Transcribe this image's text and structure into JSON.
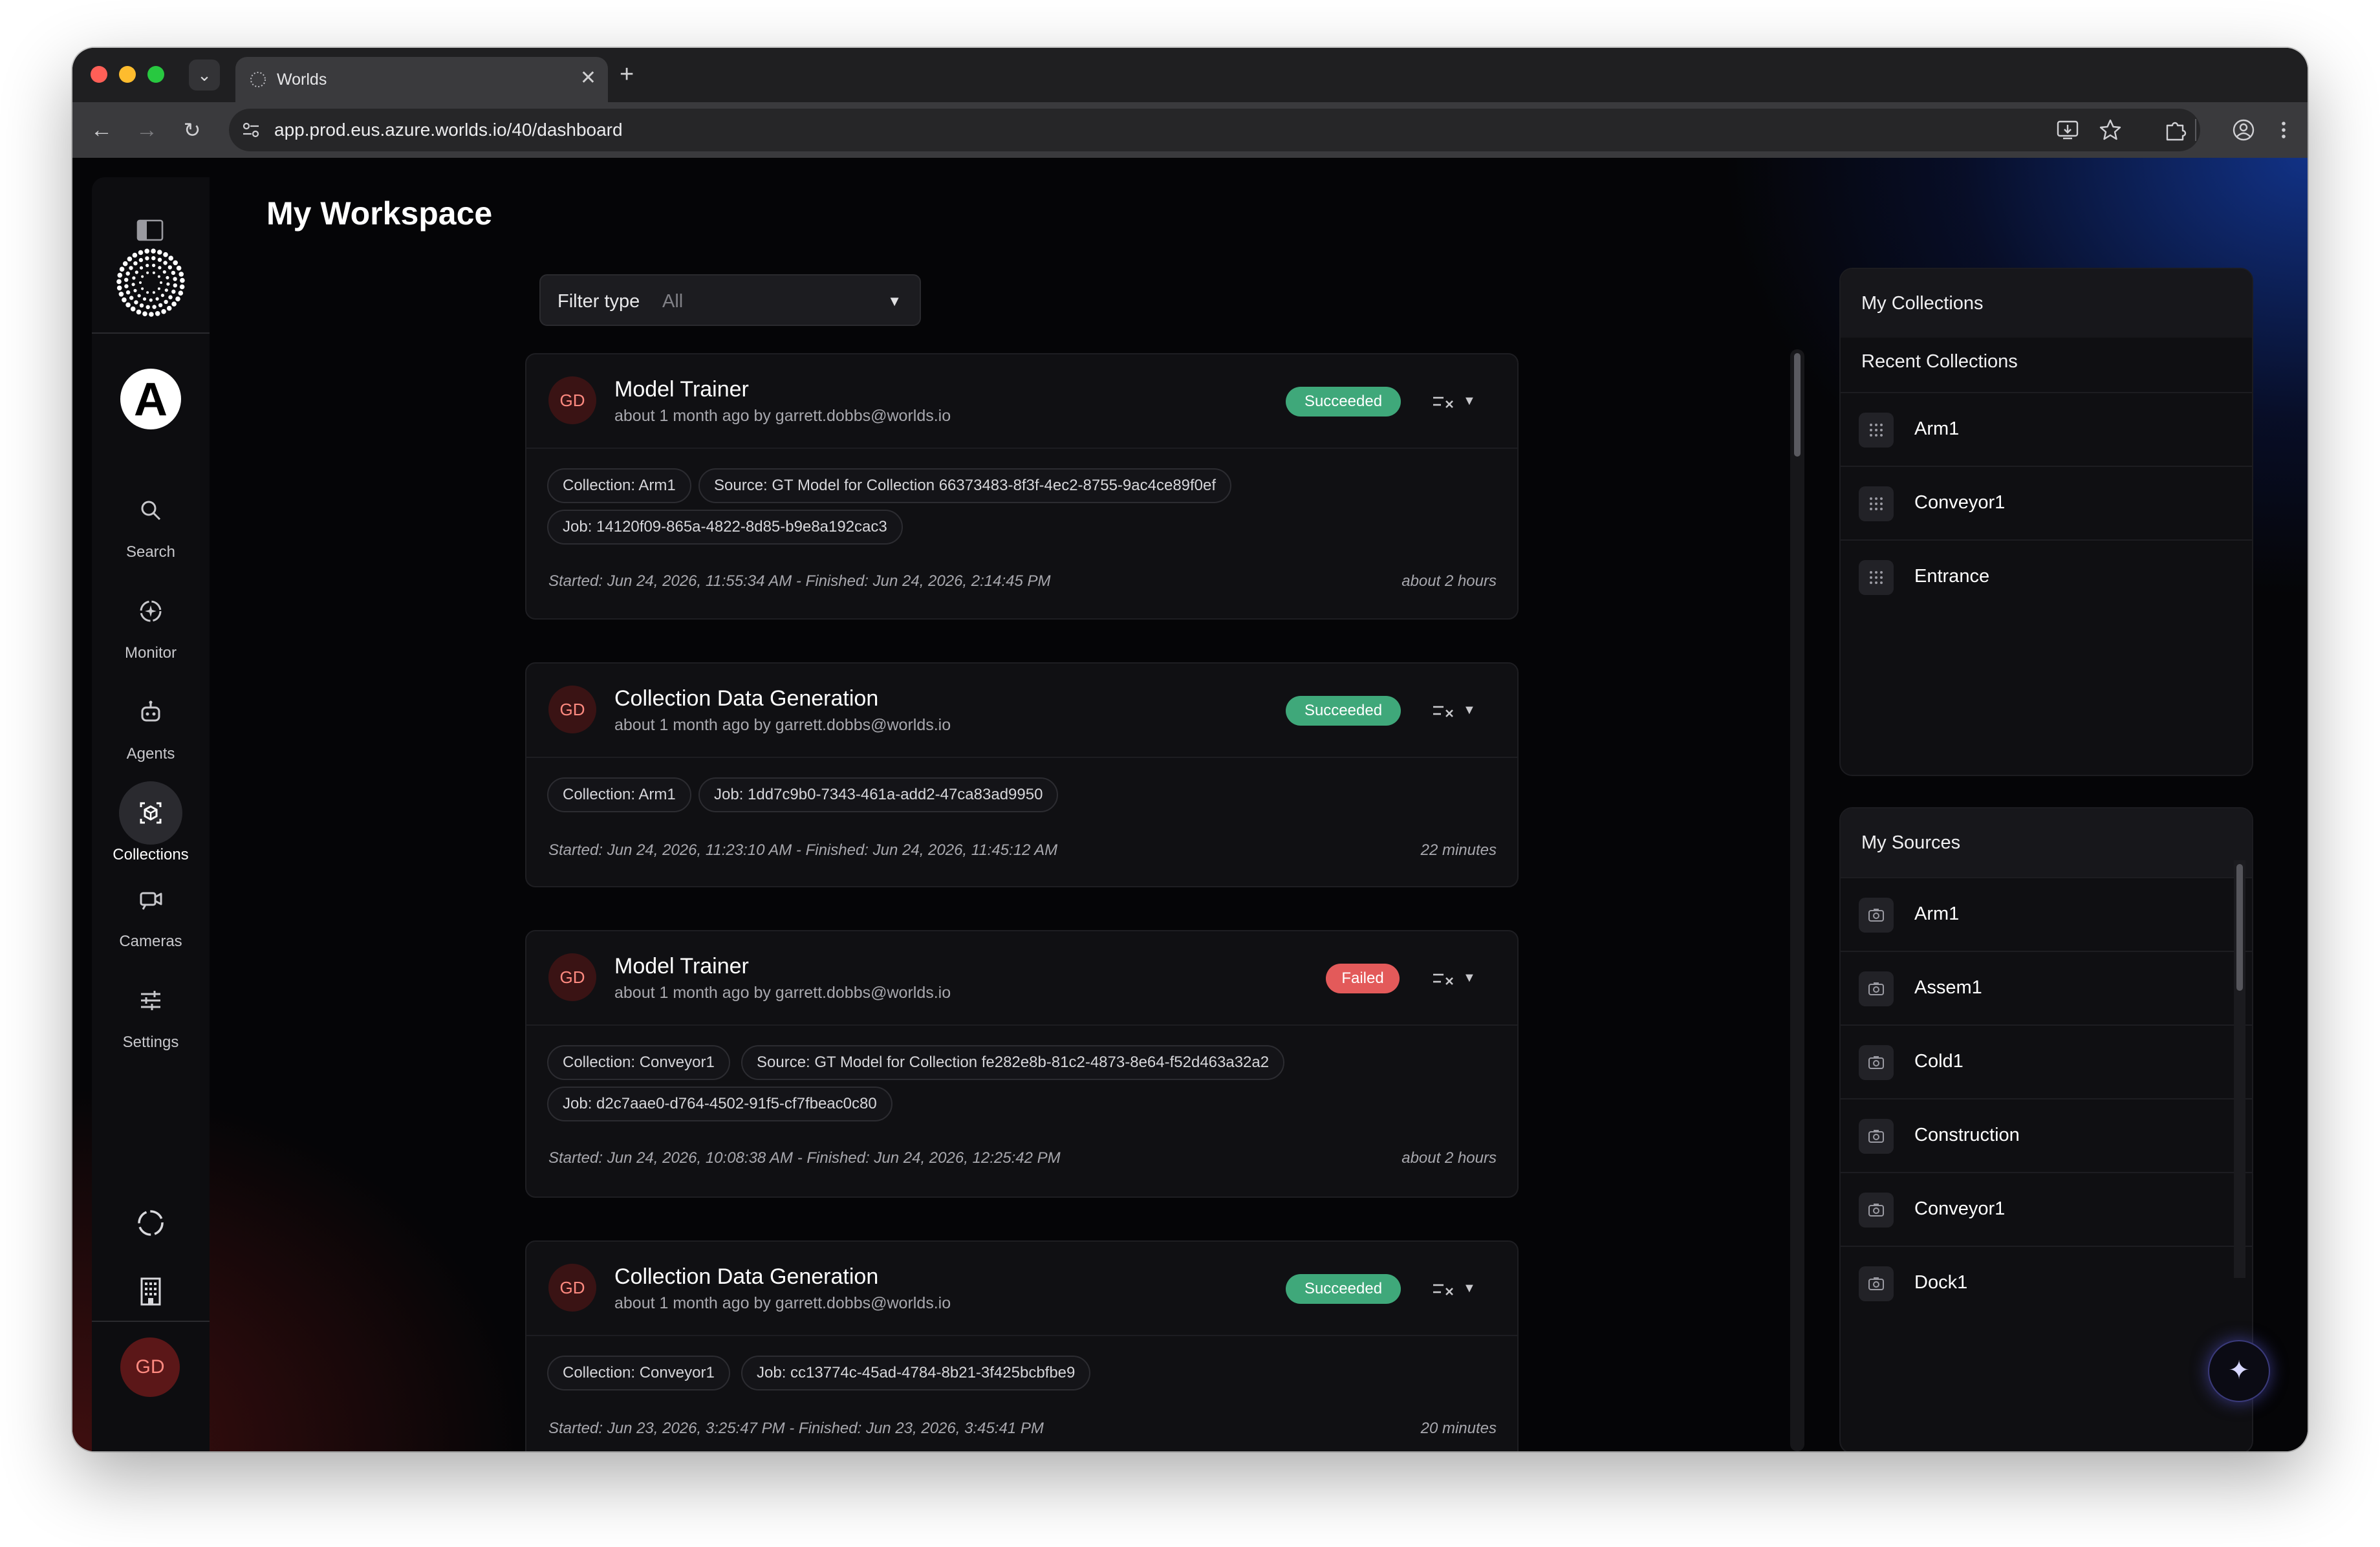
{
  "browser": {
    "tab_title": "Worlds",
    "tab_close": "✕",
    "new_tab": "+",
    "url": "app.prod.eus.azure.worlds.io/40/dashboard"
  },
  "sidebar": {
    "brand_letter": "A",
    "items": [
      {
        "label": "Search",
        "icon": "search-icon"
      },
      {
        "label": "Monitor",
        "icon": "monitor-icon"
      },
      {
        "label": "Agents",
        "icon": "robot-icon"
      },
      {
        "label": "Collections",
        "icon": "collections-icon",
        "active": true
      },
      {
        "label": "Cameras",
        "icon": "camera-icon"
      },
      {
        "label": "Settings",
        "icon": "sliders-icon"
      }
    ],
    "user_initials": "GD"
  },
  "page": {
    "title": "My Workspace"
  },
  "filter": {
    "label": "Filter type",
    "value": "All"
  },
  "jobs": [
    {
      "initials": "GD",
      "title": "Model Trainer",
      "subtitle": "about 1 month ago by garrett.dobbs@worlds.io",
      "status": "Succeeded",
      "chips": [
        "Collection: Arm1",
        "Source: GT Model for Collection 66373483-8f3f-4ec2-8755-9ac4ce89f0ef",
        "Job: 14120f09-865a-4822-8d85-b9e8a192cac3"
      ],
      "times": "Started: Jun 24, 2026, 11:55:34 AM - Finished: Jun 24, 2026, 2:14:45 PM",
      "duration": "about 2 hours"
    },
    {
      "initials": "GD",
      "title": "Collection Data Generation",
      "subtitle": "about 1 month ago by garrett.dobbs@worlds.io",
      "status": "Succeeded",
      "chips": [
        "Collection: Arm1",
        "Job: 1dd7c9b0-7343-461a-add2-47ca83ad9950"
      ],
      "times": "Started: Jun 24, 2026, 11:23:10 AM - Finished: Jun 24, 2026, 11:45:12 AM",
      "duration": "22 minutes"
    },
    {
      "initials": "GD",
      "title": "Model Trainer",
      "subtitle": "about 1 month ago by garrett.dobbs@worlds.io",
      "status": "Failed",
      "chips": [
        "Collection: Conveyor1",
        "Source: GT Model for Collection fe282e8b-81c2-4873-8e64-f52d463a32a2",
        "Job: d2c7aae0-d764-4502-91f5-cf7fbeac0c80"
      ],
      "times": "Started: Jun 24, 2026, 10:08:38 AM - Finished: Jun 24, 2026, 12:25:42 PM",
      "duration": "about 2 hours"
    },
    {
      "initials": "GD",
      "title": "Collection Data Generation",
      "subtitle": "about 1 month ago by garrett.dobbs@worlds.io",
      "status": "Succeeded",
      "chips": [
        "Collection: Conveyor1",
        "Job: cc13774c-45ad-4784-8b21-3f425bcbfbe9"
      ],
      "times": "Started: Jun 23, 2026, 3:25:47 PM - Finished: Jun 23, 2026, 3:45:41 PM",
      "duration": "20 minutes"
    }
  ],
  "collections_panel": {
    "title": "My Collections",
    "subtitle": "Recent Collections",
    "items": [
      "Arm1",
      "Conveyor1",
      "Entrance"
    ]
  },
  "sources_panel": {
    "title": "My Sources",
    "items": [
      "Arm1",
      "Assem1",
      "Cold1",
      "Construction",
      "Conveyor1",
      "Dock1"
    ]
  },
  "assistant_icon": "✦",
  "colors": {
    "success": "#3fa87a",
    "failed": "#e35a5a",
    "avatar_bg": "#3a1314",
    "avatar_text": "#ff8a80"
  }
}
